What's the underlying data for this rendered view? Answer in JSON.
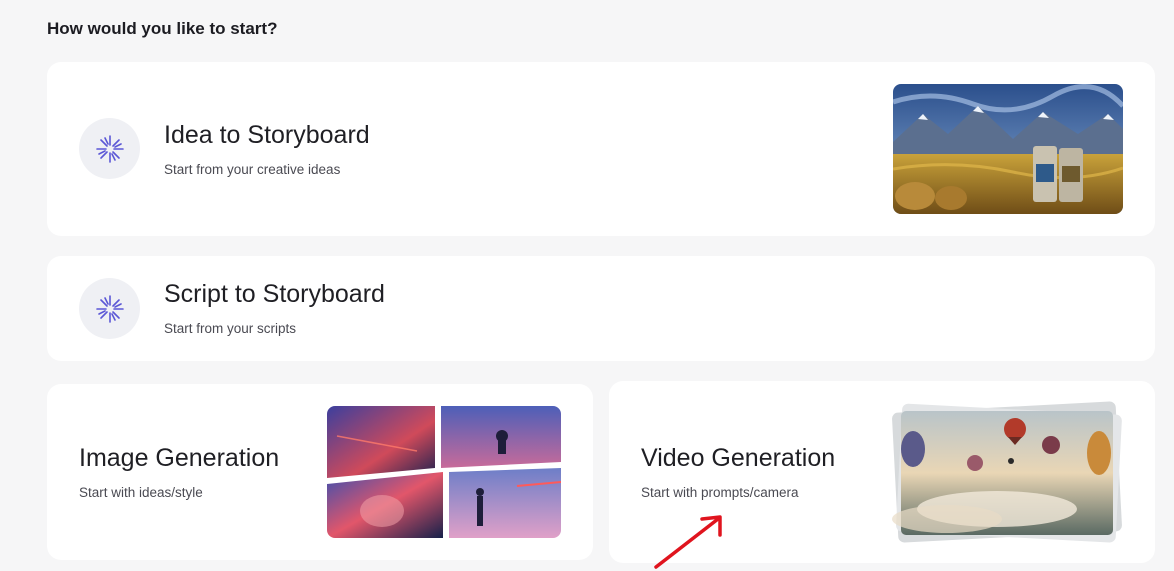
{
  "heading": "How would you like to start?",
  "cards": {
    "idea": {
      "title": "Idea to Storyboard",
      "subtitle": "Start from your creative ideas",
      "icon": "sparkle-icon"
    },
    "script": {
      "title": "Script to Storyboard",
      "subtitle": "Start from your scripts",
      "icon": "sparkle-icon"
    },
    "image": {
      "title": "Image Generation",
      "subtitle": "Start with ideas/style"
    },
    "video": {
      "title": "Video Generation",
      "subtitle": "Start with prompts/camera"
    }
  },
  "colors": {
    "background": "#f6f6f7",
    "card": "#ffffff",
    "icon_accent": "#5b57d6",
    "annotation_arrow": "#e0141e"
  }
}
